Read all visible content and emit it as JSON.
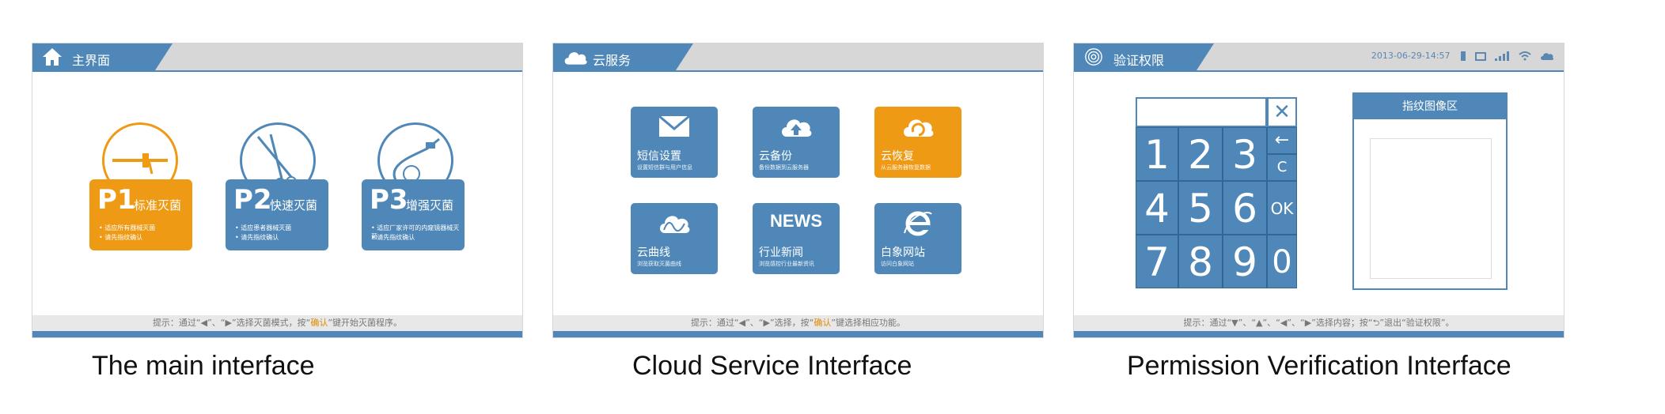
{
  "panels": {
    "main": {
      "title": "主界面",
      "hint": {
        "pre": "提示：通过“◀”、“▶”选择灭菌模式，按“",
        "key": "确认",
        "post": "”键开始灭菌程序。"
      },
      "cards": [
        {
          "num": "P1",
          "name": "标准灭菌",
          "bullet1": "• 适应所有器械灭菌",
          "bullet2": "• 请先指纹确认",
          "color": "#ef9a14"
        },
        {
          "num": "P2",
          "name": "快速灭菌",
          "bullet1": "• 适应患者器械灭菌",
          "bullet2": "• 请先指纹确认",
          "color": "#4f88b8"
        },
        {
          "num": "P3",
          "name": "增强灭菌",
          "bullet1": "• 适应厂家许可的内窥镜器械灭菌",
          "bullet2": "• 请先指纹确认",
          "color": "#4f88b8"
        }
      ],
      "caption": "The main interface"
    },
    "cloud": {
      "title": "云服务",
      "hint": {
        "pre": "提示：通过“◀”、“▶”选择，按“",
        "key": "确认",
        "post": "”键选择相应功能。"
      },
      "tiles": [
        {
          "label": "短信设置",
          "sub": "设置短信群与用户信息",
          "icon": "envelope-icon",
          "color": "#4f88b8"
        },
        {
          "label": "云备份",
          "sub": "备份数据到云服务器",
          "icon": "cloud-upload-icon",
          "color": "#4f88b8"
        },
        {
          "label": "云恢复",
          "sub": "从云服务器恢复数据",
          "icon": "cloud-restore-icon",
          "color": "#ef9a14"
        },
        {
          "label": "云曲线",
          "sub": "浏览获取灭菌曲线",
          "icon": "curve-icon",
          "color": "#4f88b8"
        },
        {
          "label": "行业新闻",
          "sub": "浏览感控行业最新资讯",
          "icon": "news-icon",
          "icon_text": "NEWS",
          "color": "#4f88b8"
        },
        {
          "label": "白象网站",
          "sub": "访问白象网站",
          "icon": "ie-browser-icon",
          "color": "#4f88b8"
        }
      ],
      "caption": "Cloud Service Interface"
    },
    "permission": {
      "title": "验证权限",
      "status": "2013-06-29-14:57",
      "hint": {
        "text": "提示：通过“▼”、“▲”、“◀”、“▶”选择内容；按“⮌”退出“验证权限”。"
      },
      "keypad": {
        "digits": [
          "1",
          "2",
          "3",
          "4",
          "5",
          "6",
          "7",
          "8",
          "9",
          "0"
        ],
        "backspace": "←",
        "clear": "C",
        "ok": "OK",
        "close": "✕"
      },
      "fingerprint_title": "指纹图像区",
      "caption": "Permission Verification Interface"
    }
  }
}
